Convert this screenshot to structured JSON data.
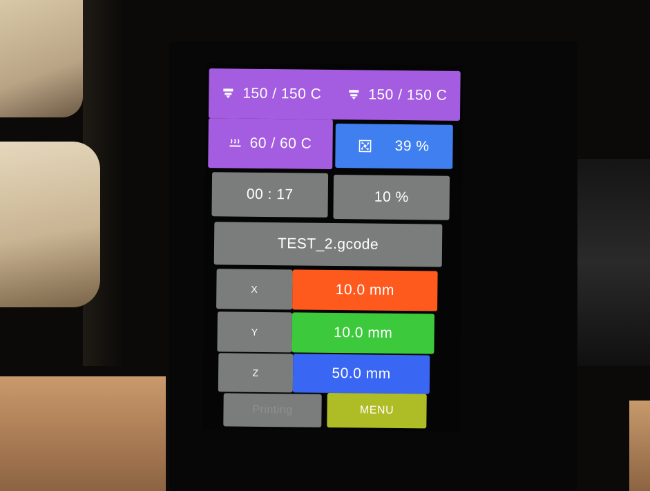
{
  "temps": {
    "extruder1": "150 / 150 C",
    "extruder2": "150 / 150 C",
    "bed": "60 / 60 C"
  },
  "fan": {
    "value": "39 %"
  },
  "status": {
    "time": "00 : 17",
    "progress": "10 %",
    "progress_fraction": 0.1
  },
  "file": {
    "name": "TEST_2.gcode"
  },
  "axes": [
    {
      "label": "X",
      "value": "10.0 mm",
      "color": "#ff5a1e"
    },
    {
      "label": "Y",
      "value": "10.0 mm",
      "color": "#3cc93c"
    },
    {
      "label": "Z",
      "value": "50.0 mm",
      "color": "#3a66f4"
    }
  ],
  "buttons": {
    "printing": "Printing",
    "menu": "MENU"
  },
  "icons": [
    "extruder-icon",
    "extruder-icon",
    "heated-bed-icon",
    "fan-icon"
  ],
  "colors": {
    "temp_panel": "#a45de0",
    "fan_tile": "#3f7ff0",
    "neutral_tile": "#7b7d7d",
    "menu_button": "#aebd26"
  }
}
